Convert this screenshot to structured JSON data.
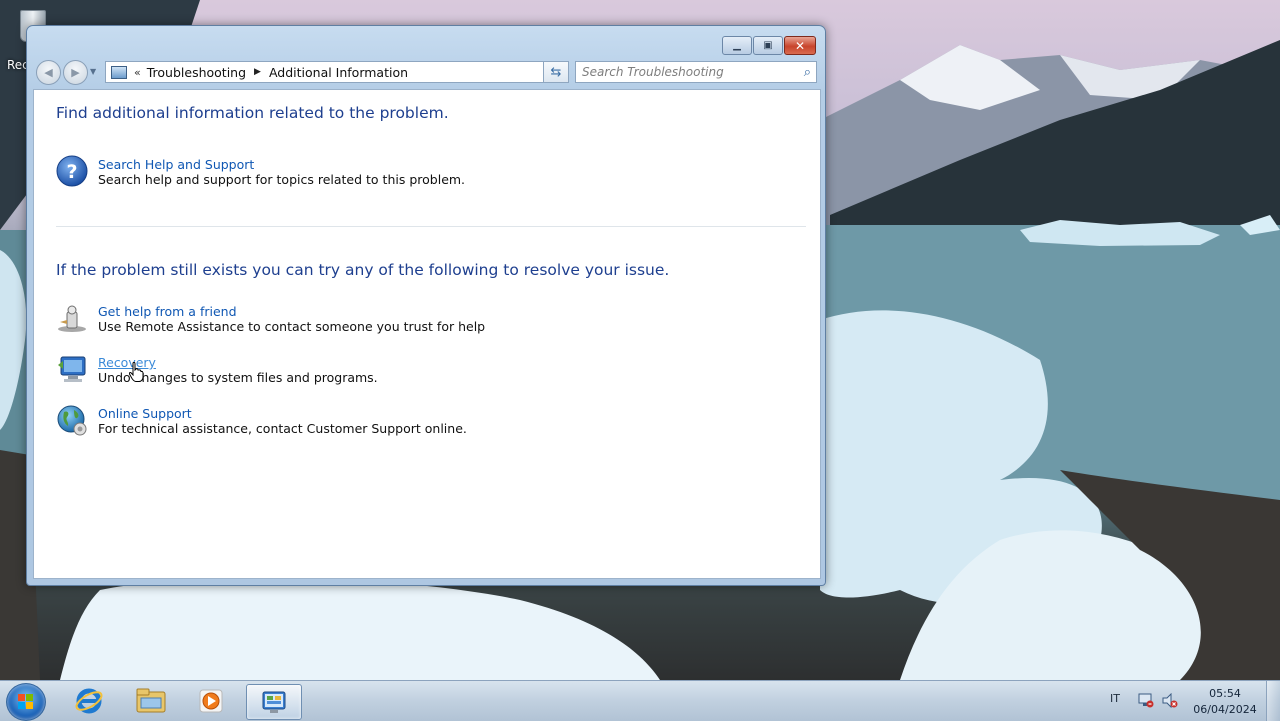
{
  "desktop": {
    "recycle_bin_label": "Rec"
  },
  "window": {
    "title_buttons": {
      "minimize": "minimize-icon",
      "maximize": "maximize-icon",
      "close": "close-icon"
    },
    "address": {
      "overflow": "«",
      "crumbs": [
        "Troubleshooting",
        "Additional Information"
      ]
    },
    "search": {
      "placeholder": "Search Troubleshooting"
    },
    "content": {
      "heading_1": "Find additional information related to the problem.",
      "help": {
        "title": "Search Help and Support",
        "description": "Search help and support for topics related to this problem."
      },
      "heading_2": "If the problem still exists you can try any of the following to resolve your issue.",
      "options": [
        {
          "title": "Get help from a friend",
          "description": "Use Remote Assistance to contact someone you trust for help",
          "icon": "remote-assistance-icon"
        },
        {
          "title": "Recovery",
          "description": "Undo changes to system files and programs.",
          "icon": "recovery-icon"
        },
        {
          "title": "Online Support",
          "description": "For technical assistance, contact Customer Support online.",
          "icon": "globe-icon"
        }
      ]
    }
  },
  "taskbar": {
    "pinned": [
      "internet-explorer-icon",
      "windows-explorer-icon",
      "media-player-icon",
      "control-panel-icon"
    ],
    "active": "control-panel-icon",
    "tray": {
      "language": "IT",
      "time": "05:54",
      "date": "06/04/2024"
    }
  },
  "colors": {
    "heading": "#1e3f8f",
    "link": "#0f57b3",
    "link_hover": "#3b8ad8"
  }
}
